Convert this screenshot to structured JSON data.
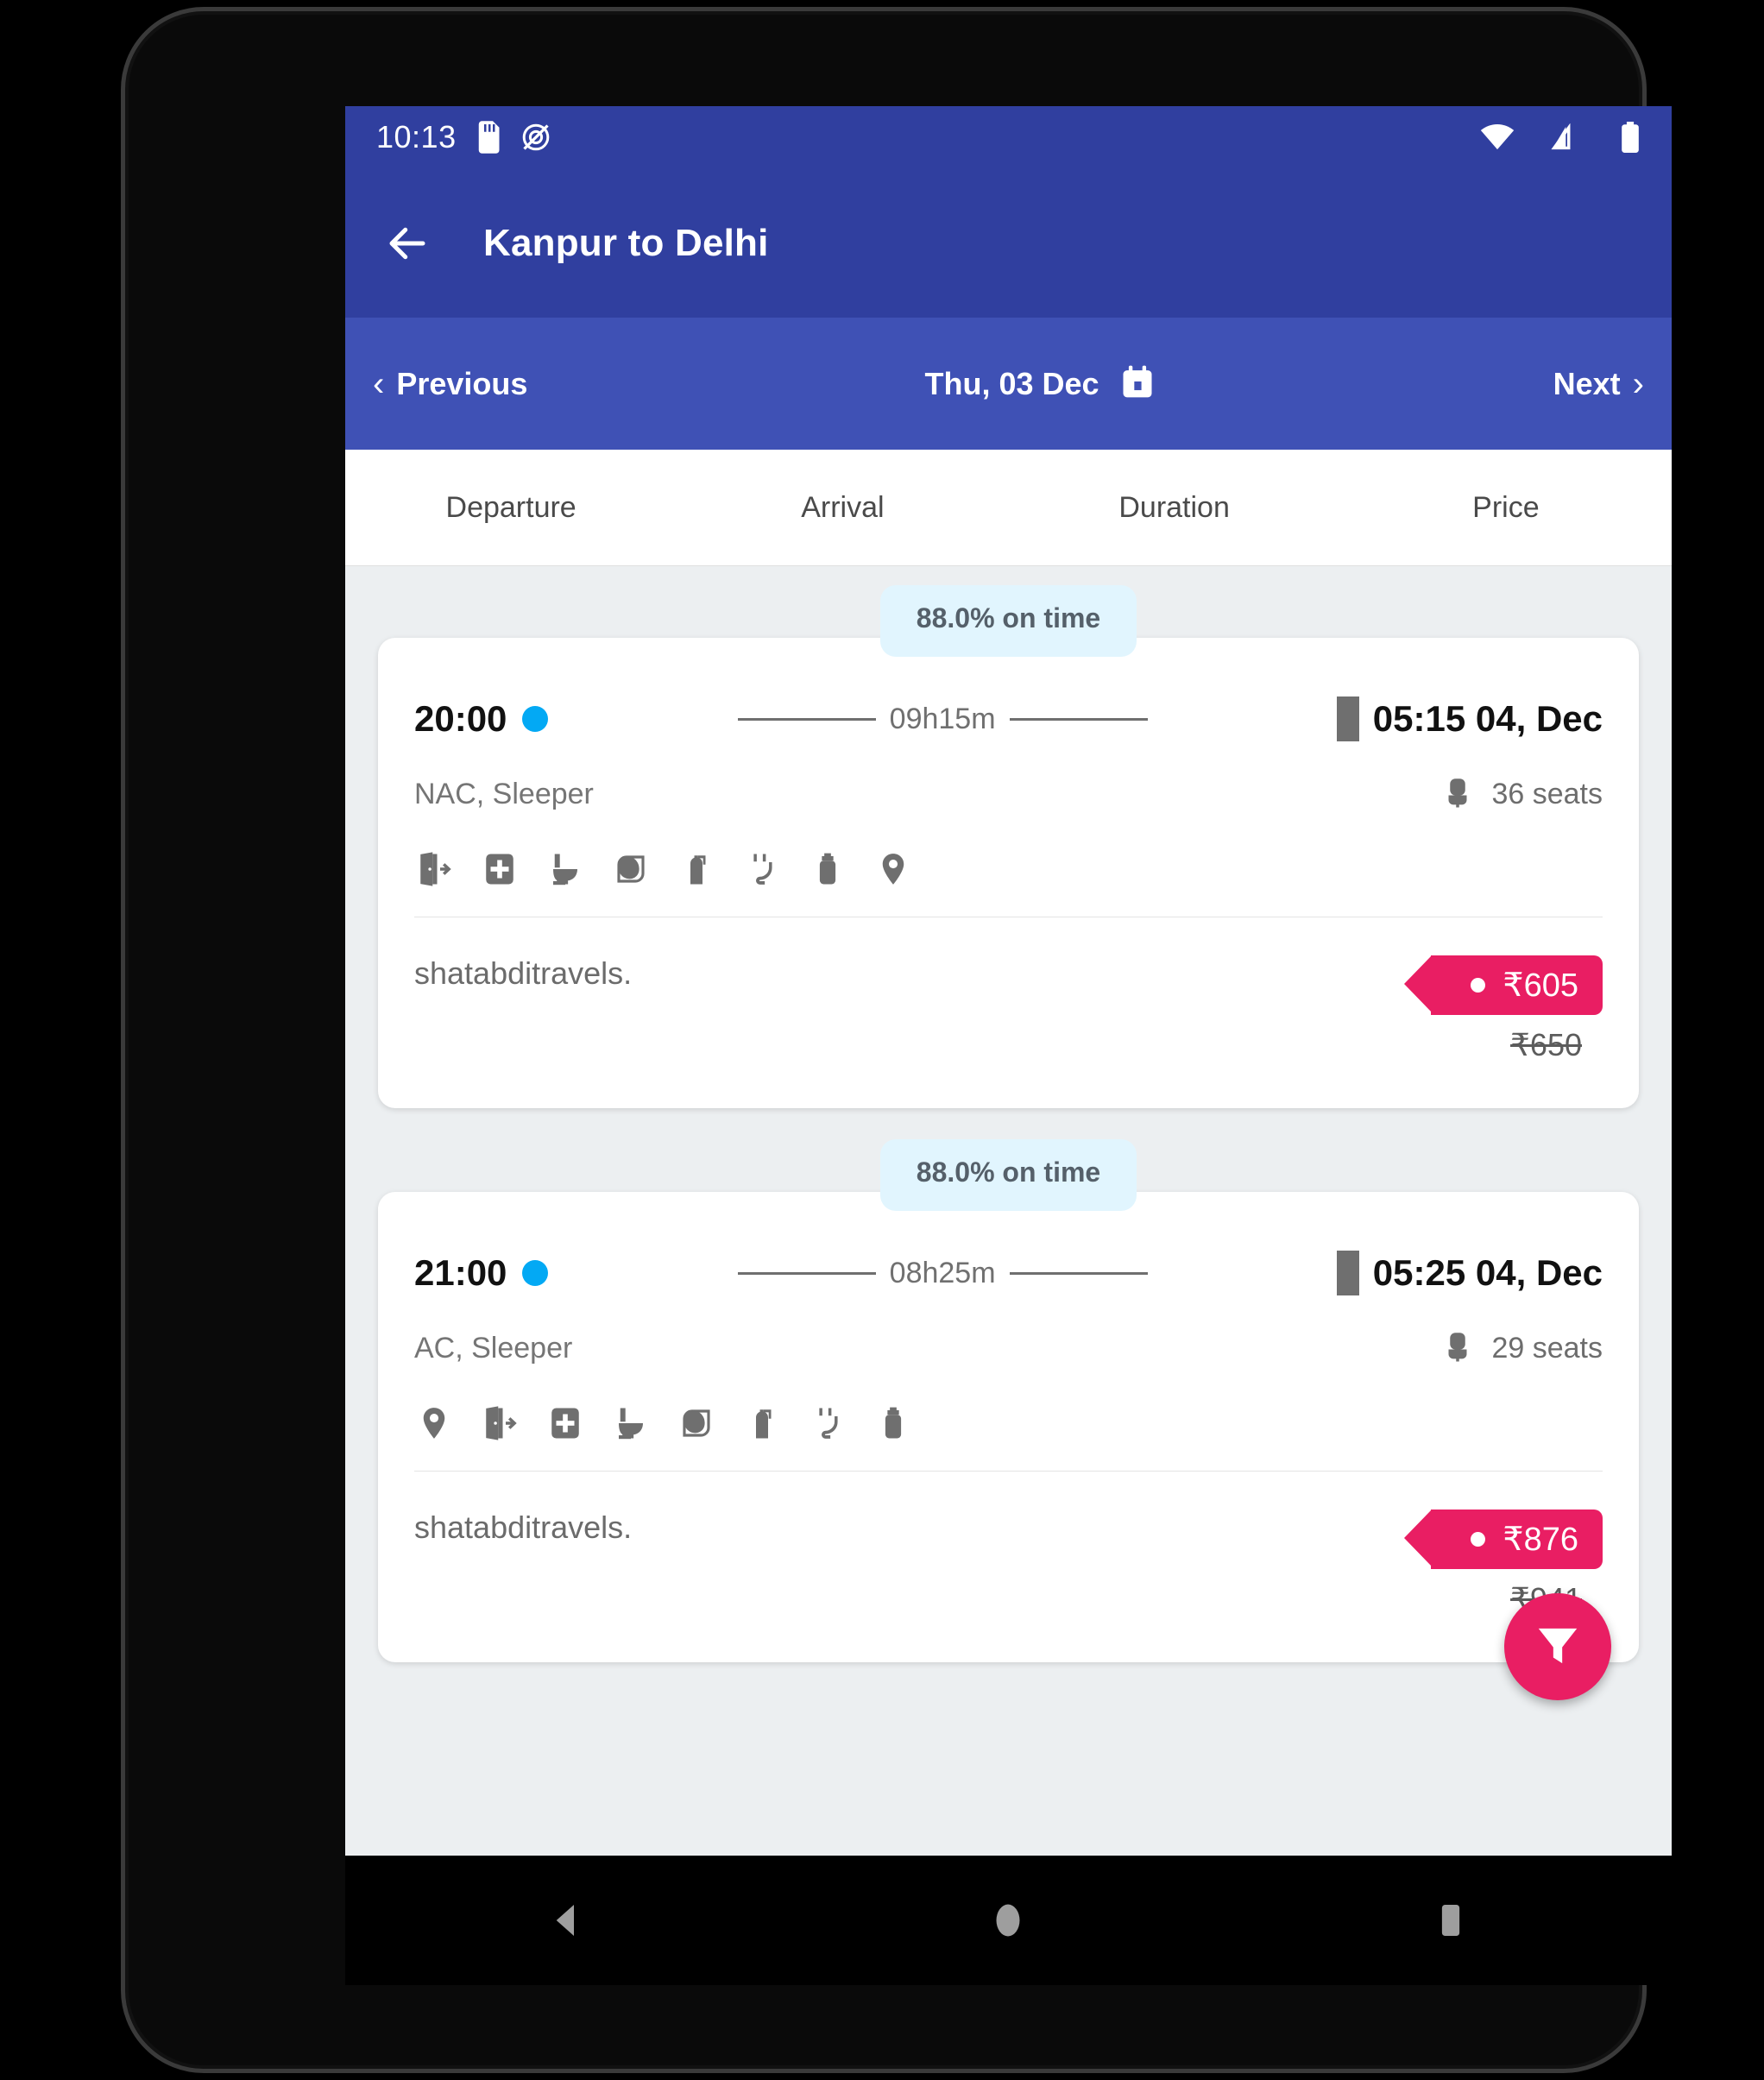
{
  "status_bar": {
    "time": "10:13",
    "icons_left": [
      "sd-card-icon",
      "do-not-disturb-icon"
    ],
    "icons_right": [
      "wifi-icon",
      "cellular-signal-icon",
      "battery-icon"
    ]
  },
  "app_bar": {
    "back_icon": "arrow-left-icon",
    "title": "Kanpur to Delhi"
  },
  "date_nav": {
    "previous_label": "Previous",
    "date_label": "Thu, 03 Dec",
    "next_label": "Next",
    "calendar_icon": "calendar-icon"
  },
  "sort_tabs": [
    {
      "label": "Departure"
    },
    {
      "label": "Arrival"
    },
    {
      "label": "Duration"
    },
    {
      "label": "Price"
    }
  ],
  "results": [
    {
      "ontime": "88.0% on time",
      "departure_time": "20:00",
      "duration": "09h15m",
      "arrival_time": "05:15 04, Dec",
      "bus_type": "NAC, Sleeper",
      "seats": "36 seats",
      "amenities": [
        "emergency-exit-icon",
        "first-aid-icon",
        "toilet-icon",
        "blanket-icon",
        "fire-extinguisher-icon",
        "charging-point-icon",
        "water-bottle-icon",
        "live-tracking-icon"
      ],
      "operator": "shatabditravels.",
      "price": "₹605",
      "old_price": "₹650"
    },
    {
      "ontime": "88.0% on time",
      "departure_time": "21:00",
      "duration": "08h25m",
      "arrival_time": "05:25 04, Dec",
      "bus_type": "AC, Sleeper",
      "seats": "29 seats",
      "amenities": [
        "live-tracking-icon",
        "emergency-exit-icon",
        "first-aid-icon",
        "toilet-icon",
        "blanket-icon",
        "fire-extinguisher-icon",
        "charging-point-icon",
        "water-bottle-icon"
      ],
      "operator": "shatabditravels.",
      "price": "₹876",
      "old_price": "₹941"
    }
  ],
  "fab": {
    "icon": "filter-funnel-icon"
  },
  "system_nav": {
    "back_icon": "triangle-back-icon",
    "home_icon": "circle-home-icon",
    "recents_icon": "square-recents-icon"
  },
  "colors": {
    "app_bar": "#303f9f",
    "date_nav": "#3f51b5",
    "accent_pink": "#e91e63",
    "dot_blue": "#03a9f4",
    "badge_bg": "#e1f5fe",
    "page_bg": "#eceff1"
  }
}
